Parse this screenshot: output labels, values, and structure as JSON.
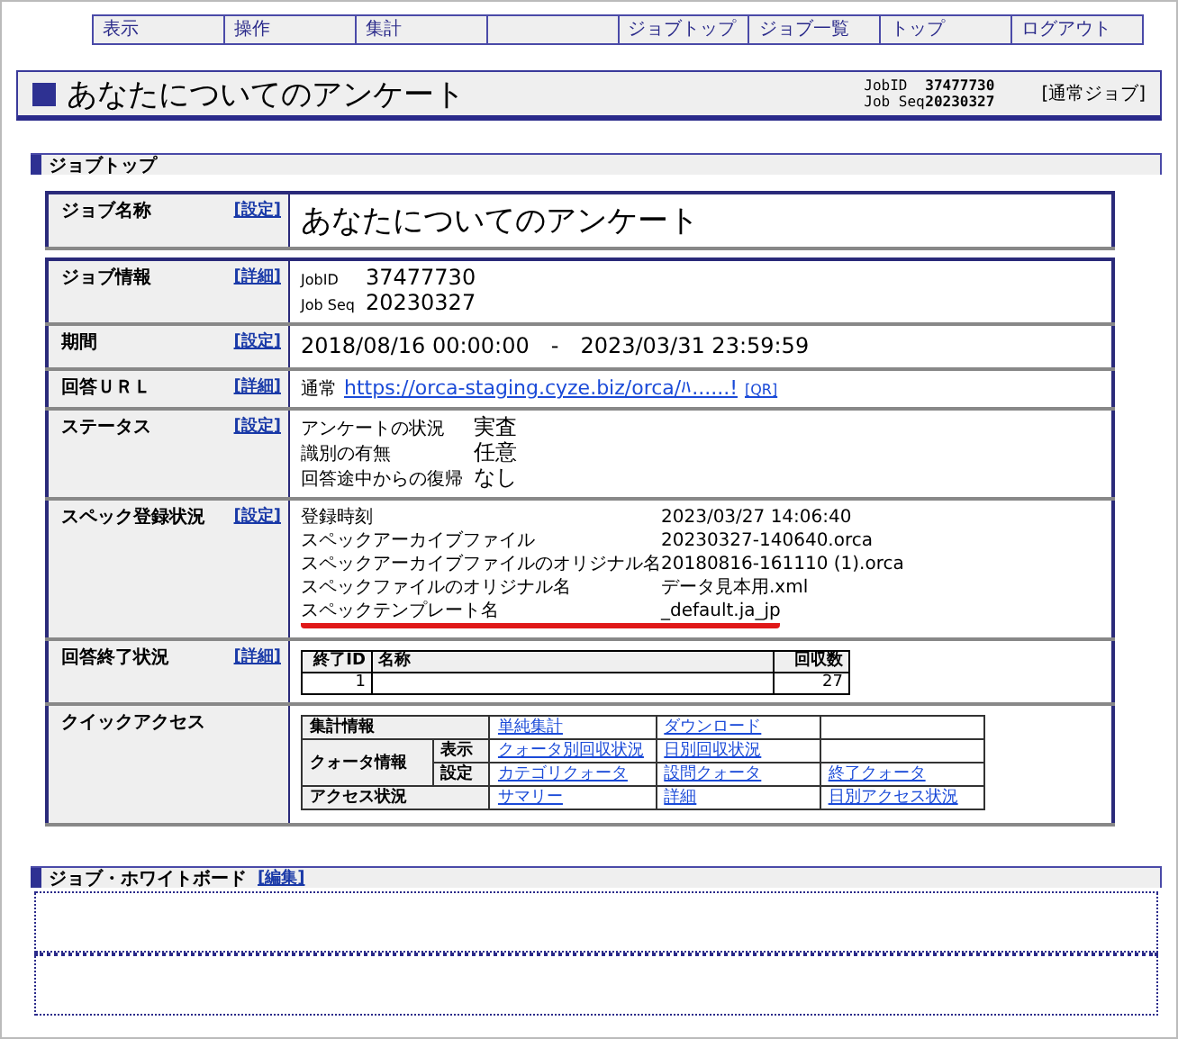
{
  "nav": [
    {
      "kind": "menu",
      "label": "表示"
    },
    {
      "kind": "menu",
      "label": "操作"
    },
    {
      "kind": "menu",
      "label": "集計"
    },
    {
      "kind": "blank"
    },
    {
      "kind": "menu",
      "label": "ジョブトップ"
    },
    {
      "kind": "menu",
      "label": "ジョブ一覧"
    },
    {
      "kind": "menu",
      "label": "トップ"
    },
    {
      "kind": "menu",
      "label": "ログアウト"
    }
  ],
  "title": {
    "text": "あなたについてのアンケート",
    "job_id_label": "JobID",
    "job_id": "37477730",
    "job_seq_label": "Job Seq",
    "job_seq": "20230327",
    "job_type": "[通常ジョブ]"
  },
  "section": {
    "title": "ジョブトップ"
  },
  "rows": [
    {
      "kind": "title",
      "label": "ジョブ名称",
      "action": "[設定]",
      "value": "あなたについてのアンケート"
    },
    {
      "kind": "pairs",
      "label": "ジョブ情報",
      "action": "[詳細]",
      "pairs": [
        {
          "key": "JobID",
          "value": "37477730"
        },
        {
          "key": "Job Seq",
          "value": "20230327"
        }
      ]
    },
    {
      "kind": "period",
      "label": "期間",
      "action": "[設定]",
      "value": "2018/08/16 00:00:00　-　2023/03/31 23:59:59"
    },
    {
      "kind": "url",
      "label": "回答ＵＲＬ",
      "action": "[詳細]",
      "prefix": "通常",
      "url": "https://orca-staging.cyze.biz/orca/ﾊ......!",
      "qr": "[QR]"
    },
    {
      "kind": "status",
      "label": "ステータス",
      "action": "[設定]",
      "pairs": [
        {
          "key": "アンケートの状況",
          "value": "実査"
        },
        {
          "key": "識別の有無",
          "value": "任意"
        },
        {
          "key": "回答途中からの復帰",
          "value": "なし"
        }
      ]
    },
    {
      "kind": "spec",
      "label": "スペック登録状況",
      "action": "[設定]",
      "pairs": [
        {
          "key": "登録時刻",
          "value": "2023/03/27 14:06:40",
          "highlighted": false
        },
        {
          "key": "スペックアーカイブファイル",
          "value": "20230327-140640.orca",
          "highlighted": false
        },
        {
          "key": "スペックアーカイブファイルのオリジナル名",
          "value": "20180816-161110 (1).orca",
          "highlighted": false
        },
        {
          "key": "スペックファイルのオリジナル名",
          "value": "データ見本用.xml",
          "highlighted": false
        },
        {
          "key": "スペックテンプレート名",
          "value": "_default.ja_jp",
          "highlighted": true
        }
      ]
    },
    {
      "kind": "completion",
      "label": "回答終了状況",
      "action": "[詳細]",
      "columns": [
        "終了ID",
        "名称",
        "回収数"
      ],
      "rows": [
        {
          "id": "1",
          "count": "27"
        }
      ]
    },
    {
      "kind": "quick",
      "label": "クイックアクセス",
      "groups": [
        {
          "group": "集計情報",
          "lines": [
            {
              "links": [
                "単純集計",
                "ダウンロード"
              ]
            }
          ]
        },
        {
          "group": "クォータ情報",
          "lines": [
            {
              "sub": "表示",
              "links": [
                "クォータ別回収状況",
                "日別回収状況"
              ]
            },
            {
              "sub": "設定",
              "links": [
                "カテゴリクォータ",
                "設問クォータ",
                "終了クォータ"
              ]
            }
          ]
        },
        {
          "group": "アクセス状況",
          "lines": [
            {
              "links": [
                "サマリー",
                "詳細",
                "日別アクセス状況"
              ]
            }
          ]
        }
      ]
    }
  ],
  "whiteboard": {
    "title": "ジョブ・ホワイトボード",
    "action": "[編集]"
  }
}
